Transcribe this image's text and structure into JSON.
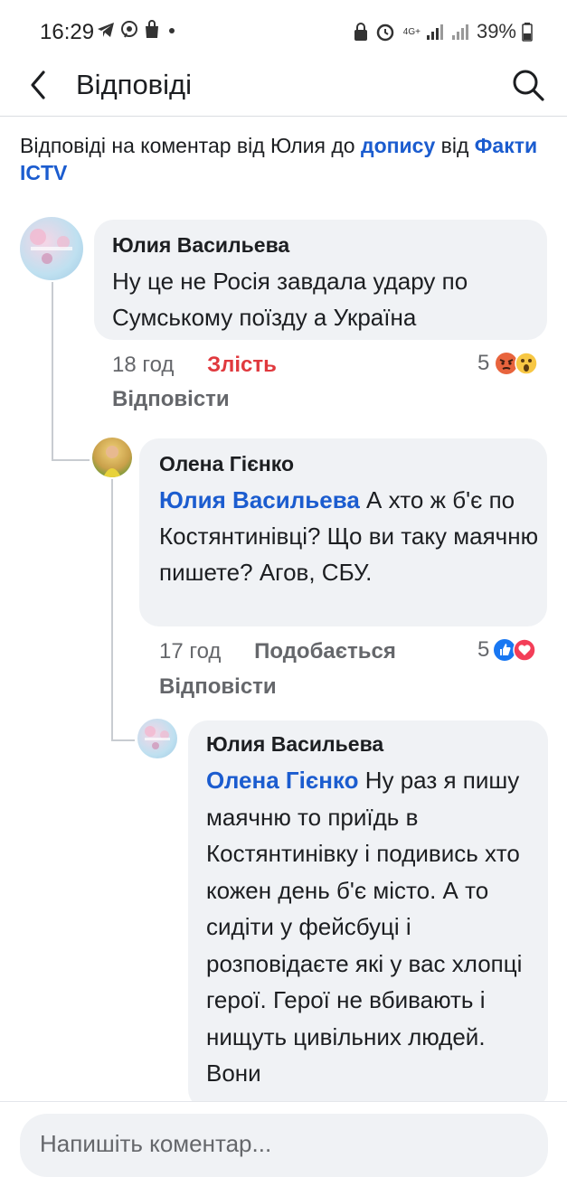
{
  "status_bar": {
    "time": "16:29",
    "battery": "39%",
    "network": "4G+"
  },
  "header": {
    "title": "Відповіді"
  },
  "context": {
    "prefix": "Відповіді на коментар від Юлия до ",
    "post_link": "допису",
    "middle": " від ",
    "page_link": "Факти ICTV"
  },
  "comments": [
    {
      "author": "Юлия Васильева",
      "mention": "",
      "text": "Ну це не Росія завдала удару по Сумському поїзду а Україна",
      "time": "18 год",
      "my_reaction": "Злість",
      "reply_label": "Відповісти",
      "reaction_count": "5",
      "reaction_icons": [
        "angry-emoji",
        "wow-emoji"
      ]
    },
    {
      "author": "Олена Гієнко",
      "mention": "Юлия Васильева",
      "text": " А хто ж б'є по Костянтинівці? Що ви таку маячню пишете? Агов, СБУ.",
      "time": "17 год",
      "my_reaction": "Подобається",
      "reply_label": "Відповісти",
      "reaction_count": "5",
      "reaction_icons": [
        "like-icon",
        "love-icon"
      ]
    },
    {
      "author": "Юлия Васильева",
      "mention": "Олена Гієнко",
      "text": " Ну раз я пишу маячню то приїдь в Костянтинівку і подивись хто кожен день б'є місто.  А то сидіти у фейсбуці і розповідаєте які у вас хлопці герої. Герої не вбивають і нищуть цивільних людей. Вони"
    }
  ],
  "composer": {
    "placeholder": "Напишіть коментар..."
  },
  "colors": {
    "link": "#1b5ccf",
    "angry": "#e0393e",
    "bubble": "#f0f2f5",
    "muted": "#65676b"
  }
}
